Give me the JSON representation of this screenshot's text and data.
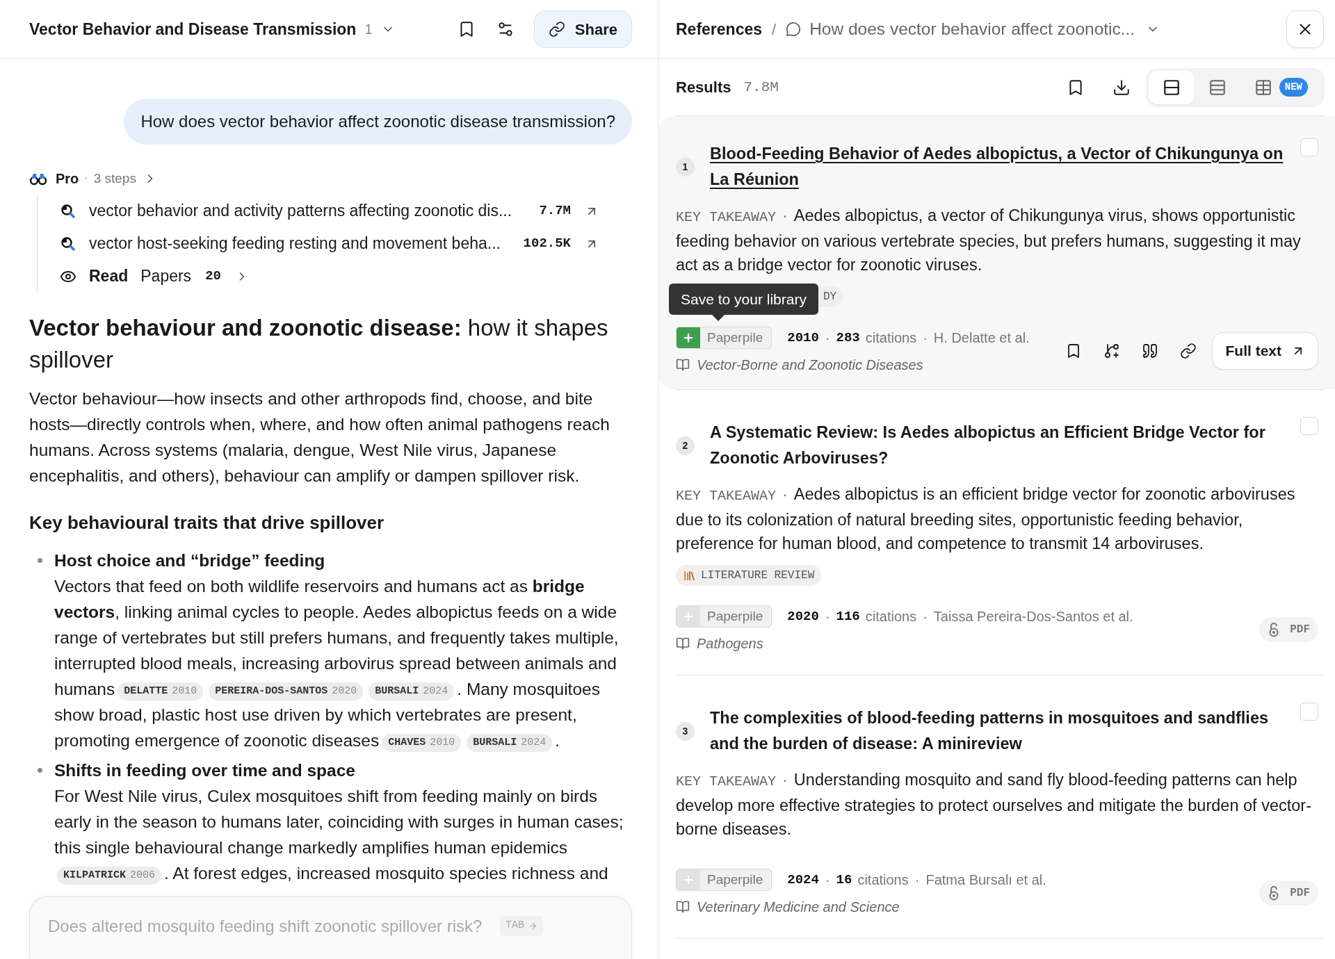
{
  "chat": {
    "title": "Vector Behavior and Disease Transmission",
    "count": "1",
    "share_label": "Share",
    "question": "How does vector behavior affect zoonotic disease transmission?",
    "pro": {
      "label": "Pro",
      "separator": "·",
      "steps": "3 steps",
      "items": [
        {
          "kind": "search",
          "text": "vector behavior and activity patterns affecting zoonotic dis...",
          "count": "7.7M"
        },
        {
          "kind": "search",
          "text": "vector host-seeking feeding resting and movement beha...",
          "count": "102.5K"
        },
        {
          "kind": "read",
          "label": "Read",
          "text": "Papers",
          "count": "20"
        }
      ]
    },
    "heading": "**Vector behaviour and zoonotic disease:** how it shapes spillover",
    "intro": "Vector behaviour—how insects and other arthropods find, choose, and bite hosts—directly controls when, where, and how often animal pathogens reach humans. Across systems (malaria, dengue, West Nile virus, Japanese encephalitis, and others), behaviour can amplify or dampen spillover risk.",
    "subheading": "Key behavioural traits that drive spillover",
    "bullets": [
      {
        "title": "Host choice and “bridge” feeding",
        "body": [
          {
            "kind": "text",
            "text": "Vectors that feed on both wildlife reservoirs and humans act as **bridge vectors**, linking animal cycles to people. Aedes albopictus feeds on a wide range of vertebrates but still prefers humans, and frequently takes multiple, interrupted blood meals, increasing arbovirus spread between animals and humans"
          },
          {
            "kind": "cite",
            "name": "DELATTE",
            "year": "2010"
          },
          {
            "kind": "cite",
            "name": "PEREIRA-DOS-SANTOS",
            "year": "2020"
          },
          {
            "kind": "cite",
            "name": "BURSALI",
            "year": "2024"
          },
          {
            "kind": "text",
            "text": ". Many mosquitoes show broad, plastic host use driven by which vertebrates are present, promoting emergence of zoonotic diseases"
          },
          {
            "kind": "cite",
            "name": "CHAVES",
            "year": "2010"
          },
          {
            "kind": "cite",
            "name": "BURSALI",
            "year": "2024"
          },
          {
            "kind": "text",
            "text": "."
          }
        ]
      },
      {
        "title": "Shifts in feeding over time and space",
        "body": [
          {
            "kind": "text",
            "text": "For West Nile virus, Culex mosquitoes shift from feeding mainly on birds early in the season to humans later, coinciding with surges in human cases; this single behavioural change markedly amplifies human epidemics"
          },
          {
            "kind": "cite",
            "name": "KILPATRICK",
            "year": "2006"
          },
          {
            "kind": "text",
            "text": ". At forest edges, increased mosquito species richness and"
          }
        ]
      }
    ],
    "composer": {
      "placeholder": "Does altered mosquito feeding shift zoonotic spillover risk?",
      "hint": "TAB"
    }
  },
  "references": {
    "title": "References",
    "separator": "/",
    "query": "How does vector behavior affect zoonotic...",
    "results_label": "Results",
    "results_count": "7.8M",
    "views": [
      {
        "kind": "card",
        "selected": true
      },
      {
        "kind": "list",
        "selected": false
      },
      {
        "kind": "table",
        "selected": false,
        "badge": "NEW"
      }
    ],
    "papers": [
      {
        "number": "1",
        "separator": "·",
        "hovered": true,
        "checked": false,
        "title": "Blood-Feeding Behavior of Aedes albopictus, a Vector of Chikungunya on La Réunion",
        "takeaway_label": "KEY TAKEAWAY",
        "takeaway": "Aedes albopictus, a vector of Chikungunya virus, shows opportunistic feeding behavior on various vertebrate species, but prefers humans, suggesting it may act as a bridge vector for zoonotic viruses.",
        "tag": {
          "kind": "study",
          "label": "DY"
        },
        "tooltip": "Save to your library",
        "paperpile": "Paperpile",
        "year": "2010",
        "citations": "283",
        "citations_label": "citations",
        "authors": "H. Delatte et al.",
        "journal": "Vector-Borne and Zoonotic Diseases",
        "full_text": "Full text"
      },
      {
        "number": "2",
        "separator": "·",
        "hovered": false,
        "checked": false,
        "title": "A Systematic Review: Is Aedes albopictus an Efficient Bridge Vector for Zoonotic Arboviruses?",
        "takeaway_label": "KEY TAKEAWAY",
        "takeaway": "Aedes albopictus is an efficient bridge vector for zoonotic arboviruses due to its colonization of natural breeding sites, opportunistic feeding behavior, preference for human blood, and competence to transmit 14 arboviruses.",
        "tag": {
          "kind": "review",
          "label": "LITERATURE REVIEW"
        },
        "paperpile": "Paperpile",
        "year": "2020",
        "citations": "116",
        "citations_label": "citations",
        "authors": "Taissa Pereira-Dos-Santos et al.",
        "journal": "Pathogens",
        "access": "PDF"
      },
      {
        "number": "3",
        "separator": "·",
        "hovered": false,
        "checked": false,
        "title": "The complexities of blood-feeding patterns in mosquitoes and sandflies and the burden of disease: A minireview",
        "takeaway_label": "KEY TAKEAWAY",
        "takeaway": "Understanding mosquito and sand fly blood-feeding patterns can help develop more effective strategies to protect ourselves and mitigate the burden of vector-borne diseases.",
        "paperpile": "Paperpile",
        "year": "2024",
        "citations": "16",
        "citations_label": "citations",
        "authors": "Fatma Bursalı et al.",
        "journal": "Veterinary Medicine and Science",
        "access": "PDF"
      }
    ]
  }
}
